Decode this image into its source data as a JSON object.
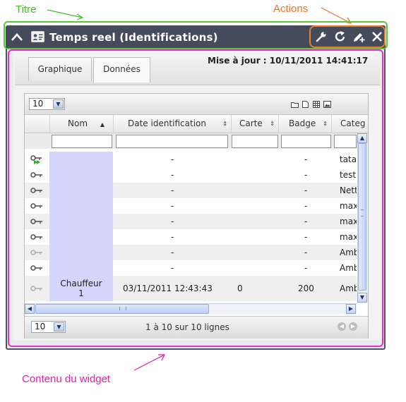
{
  "annotations": {
    "titre": "Titre",
    "actions": "Actions",
    "contenu": "Contenu du widget"
  },
  "colors": {
    "title_outline": "#56c83a",
    "actions_outline": "#f07a28",
    "content_outline": "#e630c0",
    "titlebar": "#444c5c",
    "selected_column": "#d4d6fb"
  },
  "widget": {
    "title": "Temps reel (Identifications)",
    "collapse_icon": "chevron-up-icon",
    "type_icon": "id-card-icon",
    "actions": [
      {
        "name": "settings-action",
        "icon": "wrench-icon"
      },
      {
        "name": "refresh-action",
        "icon": "refresh-icon"
      },
      {
        "name": "edit-action",
        "icon": "edit-add-icon"
      },
      {
        "name": "close-action",
        "icon": "close-icon"
      }
    ]
  },
  "tabs": [
    {
      "label": "Graphique",
      "active": false
    },
    {
      "label": "Données",
      "active": true
    }
  ],
  "update": {
    "text": "Mise à jour : 10/11/2011 14:41:17"
  },
  "grid": {
    "page_size": "10",
    "toolbar_icons": [
      "folder-icon",
      "page-icon",
      "table-icon",
      "image-icon"
    ],
    "columns": [
      "Nom",
      "Date identification",
      "Carte",
      "Badge",
      "Categ"
    ],
    "rows": [
      {
        "icon": "key-play-icon",
        "nom": "",
        "date": "-",
        "carte": "",
        "badge": "-",
        "categ": "tata"
      },
      {
        "icon": "key-icon",
        "nom": "",
        "date": "-",
        "carte": "",
        "badge": "-",
        "categ": "test"
      },
      {
        "icon": "key-icon",
        "nom": "",
        "date": "-",
        "carte": "",
        "badge": "-",
        "categ": "Nett"
      },
      {
        "icon": "key-icon",
        "nom": "",
        "date": "-",
        "carte": "",
        "badge": "-",
        "categ": "max"
      },
      {
        "icon": "key-icon",
        "nom": "",
        "date": "-",
        "carte": "",
        "badge": "-",
        "categ": "max"
      },
      {
        "icon": "key-icon",
        "nom": "",
        "date": "-",
        "carte": "",
        "badge": "-",
        "categ": "max"
      },
      {
        "icon": "key-faded-icon",
        "nom": "",
        "date": "-",
        "carte": "",
        "badge": "-",
        "categ": "Amb"
      },
      {
        "icon": "key-icon",
        "nom": "",
        "date": "-",
        "carte": "",
        "badge": "-",
        "categ": "Amb"
      },
      {
        "icon": "key-faded-icon",
        "nom_line1": "Chauffeur",
        "nom_line2": "1",
        "date": "03/11/2011 12:43:43",
        "carte": "0",
        "badge": "200",
        "categ": "Amb"
      }
    ],
    "footer_page_size": "10",
    "pagination_text": "1 à 10 sur 10 lignes"
  }
}
